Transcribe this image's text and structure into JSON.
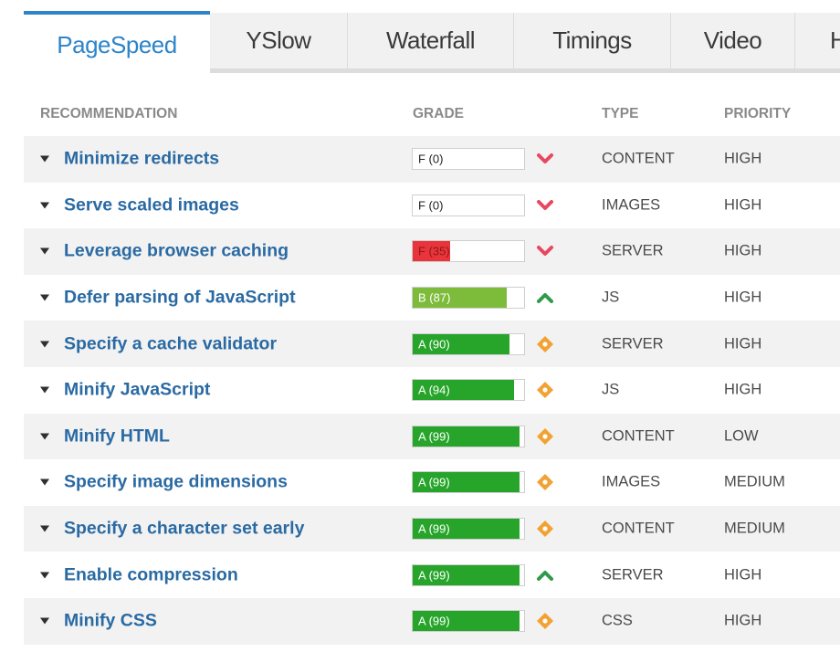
{
  "tabs": [
    {
      "label": "PageSpeed",
      "active": true
    },
    {
      "label": "YSlow",
      "active": false
    },
    {
      "label": "Waterfall",
      "active": false
    },
    {
      "label": "Timings",
      "active": false
    },
    {
      "label": "Video",
      "active": false
    },
    {
      "label": "H",
      "active": false
    }
  ],
  "columns": {
    "recommendation": "RECOMMENDATION",
    "grade": "GRADE",
    "type": "TYPE",
    "priority": "PRIORITY"
  },
  "colors": {
    "accent": "#2d84c9",
    "grade_red": "#e8343a",
    "grade_lightgreen": "#7dbb3a",
    "grade_green": "#27a52b",
    "indicator_down": "#e8485f",
    "indicator_up": "#2f9a4a",
    "indicator_neutral": "#f1a233"
  },
  "rows": [
    {
      "recommendation": "Minimize redirects",
      "grade": "F (0)",
      "score": 0,
      "indicator": "chevron-down-icon",
      "type": "CONTENT",
      "priority": "HIGH"
    },
    {
      "recommendation": "Serve scaled images",
      "grade": "F (0)",
      "score": 0,
      "indicator": "chevron-down-icon",
      "type": "IMAGES",
      "priority": "HIGH"
    },
    {
      "recommendation": "Leverage browser caching",
      "grade": "F (35)",
      "score": 35,
      "indicator": "chevron-down-icon",
      "type": "SERVER",
      "priority": "HIGH"
    },
    {
      "recommendation": "Defer parsing of JavaScript",
      "grade": "B (87)",
      "score": 87,
      "indicator": "chevron-up-icon",
      "type": "JS",
      "priority": "HIGH"
    },
    {
      "recommendation": "Specify a cache validator",
      "grade": "A (90)",
      "score": 90,
      "indicator": "diamond-icon",
      "type": "SERVER",
      "priority": "HIGH"
    },
    {
      "recommendation": "Minify JavaScript",
      "grade": "A (94)",
      "score": 94,
      "indicator": "diamond-icon",
      "type": "JS",
      "priority": "HIGH"
    },
    {
      "recommendation": "Minify HTML",
      "grade": "A (99)",
      "score": 99,
      "indicator": "diamond-icon",
      "type": "CONTENT",
      "priority": "LOW"
    },
    {
      "recommendation": "Specify image dimensions",
      "grade": "A (99)",
      "score": 99,
      "indicator": "diamond-icon",
      "type": "IMAGES",
      "priority": "MEDIUM"
    },
    {
      "recommendation": "Specify a character set early",
      "grade": "A (99)",
      "score": 99,
      "indicator": "diamond-icon",
      "type": "CONTENT",
      "priority": "MEDIUM"
    },
    {
      "recommendation": "Enable compression",
      "grade": "A (99)",
      "score": 99,
      "indicator": "chevron-up-icon",
      "type": "SERVER",
      "priority": "HIGH"
    },
    {
      "recommendation": "Minify CSS",
      "grade": "A (99)",
      "score": 99,
      "indicator": "diamond-icon",
      "type": "CSS",
      "priority": "HIGH"
    }
  ]
}
